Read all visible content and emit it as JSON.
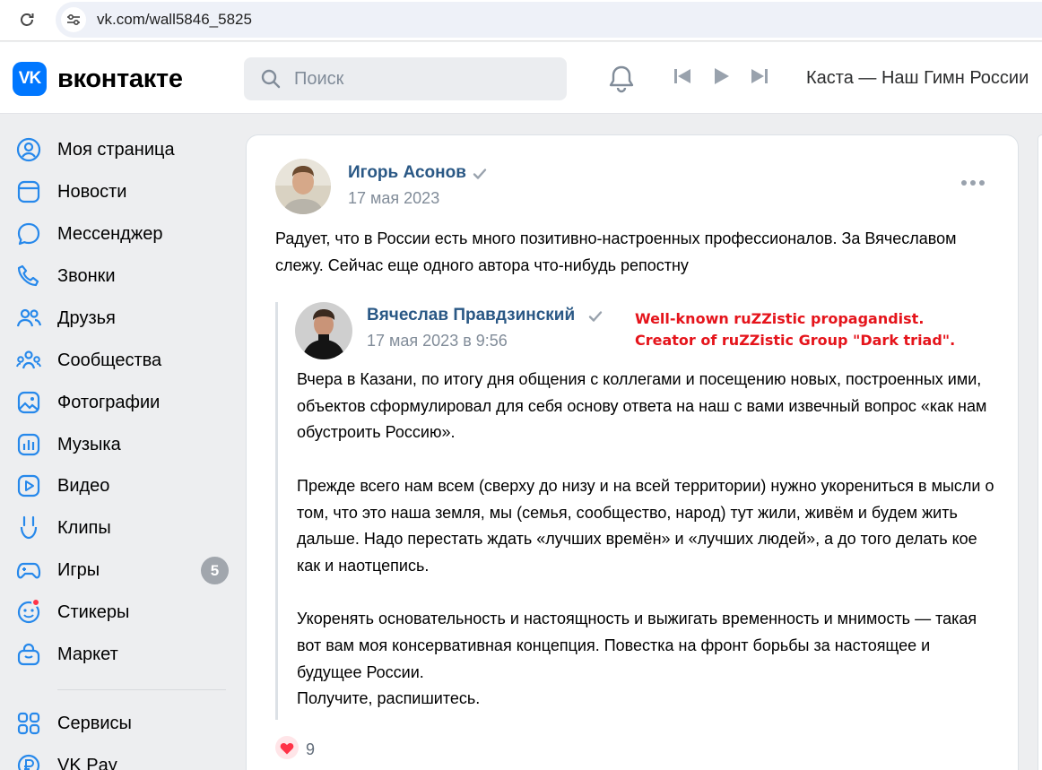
{
  "browser": {
    "url": "vk.com/wall5846_5825"
  },
  "header": {
    "logo_mark": "VK",
    "logo_text": "вконтакте",
    "search_placeholder": "Поиск",
    "now_playing": "Каста — Наш Гимн России"
  },
  "sidebar": {
    "items": [
      {
        "label": "Моя страница",
        "icon": "user-circle-icon"
      },
      {
        "label": "Новости",
        "icon": "news-icon"
      },
      {
        "label": "Мессенджер",
        "icon": "message-icon"
      },
      {
        "label": "Звонки",
        "icon": "phone-icon"
      },
      {
        "label": "Друзья",
        "icon": "friends-icon"
      },
      {
        "label": "Сообщества",
        "icon": "communities-icon"
      },
      {
        "label": "Фотографии",
        "icon": "photo-icon"
      },
      {
        "label": "Музыка",
        "icon": "music-icon"
      },
      {
        "label": "Видео",
        "icon": "video-icon"
      },
      {
        "label": "Клипы",
        "icon": "clips-icon"
      },
      {
        "label": "Игры",
        "icon": "gamepad-icon",
        "badge": "5"
      },
      {
        "label": "Стикеры",
        "icon": "sticker-icon"
      },
      {
        "label": "Маркет",
        "icon": "market-icon"
      },
      {
        "label": "Сервисы",
        "icon": "services-icon"
      },
      {
        "label": "VK Pay",
        "icon": "vkpay-icon"
      }
    ]
  },
  "post": {
    "author": "Игорь Асонов",
    "date": "17 мая 2023",
    "text": "Радует, что в России есть много позитивно-настроенных профессионалов. За Вячеславом слежу. Сейчас еще одного автора что-нибудь репостну",
    "likes": "9"
  },
  "repost": {
    "author": "Вячеслав Правдзинский",
    "date": "17 мая 2023 в 9:56",
    "paragraphs": [
      "Вчера в Казани, по итогу дня общения с коллегами и посещению новых, построенных ими, объектов сформулировал для себя основу ответа на наш с вами извечный вопрос «как нам обустроить Россию».",
      "Прежде всего нам всем (сверху до низу и на всей территории) нужно укорениться в мысли о том, что это наша земля, мы (семья, сообщество, народ) тут жили, живём и будем жить дальше. Надо перестать ждать «лучших времён» и «лучших людей», а до того делать кое как и наотцепись.",
      "Укоренять основательность и настоящность и выжигать временность и мнимость — такая вот вам моя консервативная концепция. Повестка на фронт борьбы за настоящее и будущее России.\nПолучите, распишитесь."
    ]
  },
  "annotation": {
    "line1": "Well-known ruZZistic propagandist.",
    "line2": "Creator of ruZZistic Group \"Dark triad\"."
  },
  "colors": {
    "vk_blue": "#0077ff",
    "link": "#2a5885",
    "annotation_red": "#e5141b",
    "like_red": "#ff3347"
  }
}
